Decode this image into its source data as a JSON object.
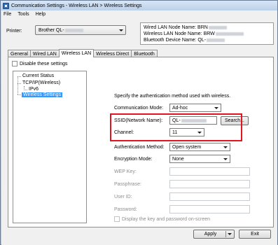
{
  "window": {
    "title": "Communication Settings - Wireless LAN > Wireless Settings",
    "icon": "app-icon"
  },
  "menu": [
    "File",
    "Tools",
    "Help"
  ],
  "printer": {
    "label": "Printer:",
    "value": "Brother QL-"
  },
  "info": {
    "line1": "Wired LAN Node Name: BRN",
    "line2": "Wireless LAN Node Name: BRW",
    "line3": "Bluetooth Device Name: QL-"
  },
  "tabs": [
    "General",
    "Wired LAN",
    "Wireless LAN",
    "Wireless Direct",
    "Bluetooth"
  ],
  "active_tab": "Wireless LAN",
  "disable_settings": {
    "label": "Disable these settings",
    "checked": false
  },
  "tree": {
    "items": [
      "Current Status",
      "TCP/IP(Wireless)",
      "IPv6",
      "Wireless Settings"
    ],
    "selected": "Wireless Settings"
  },
  "form": {
    "description": "Specify the authentication method used with wireless.",
    "communication_mode": {
      "label": "Communication Mode:",
      "value": "Ad-hoc"
    },
    "ssid": {
      "label": "SSID(Network Name):",
      "value": "QL-"
    },
    "search_button": "Search...",
    "channel": {
      "label": "Channel:",
      "value": "11"
    },
    "auth_method": {
      "label": "Authentication Method:",
      "value": "Open system"
    },
    "encryption_mode": {
      "label": "Encryption Mode:",
      "value": "None"
    },
    "wep_key": {
      "label": "WEP Key:"
    },
    "passphrase": {
      "label": "Passphrase:"
    },
    "user_id": {
      "label": "User ID:"
    },
    "password": {
      "label": "Password:"
    },
    "display_key": {
      "label": "Display the key and password on-screen",
      "checked": false
    }
  },
  "buttons": {
    "apply": "Apply",
    "exit": "Exit"
  },
  "colors": {
    "highlight": "#e2141f",
    "selection": "#3399ff"
  }
}
